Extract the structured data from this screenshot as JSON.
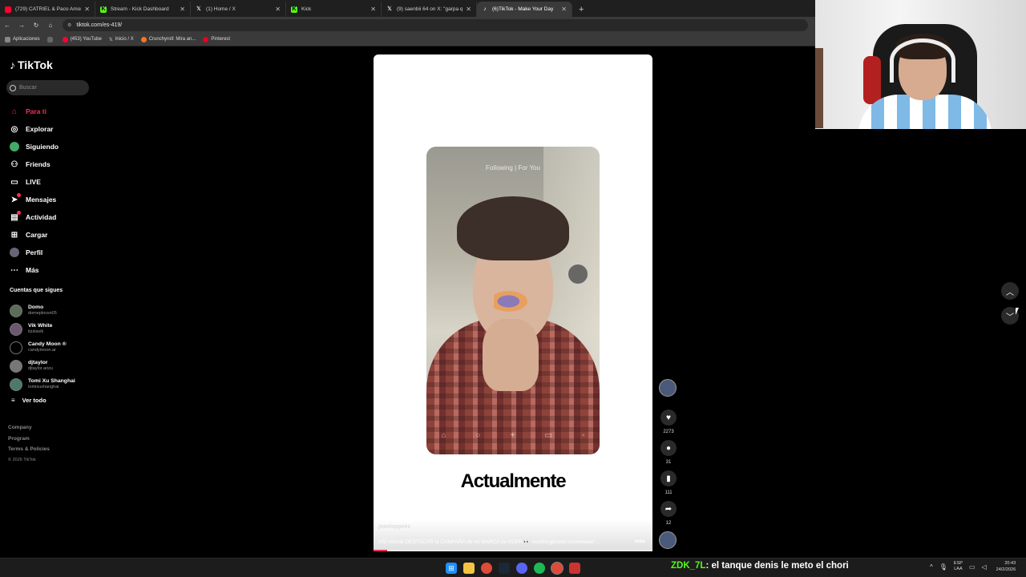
{
  "browser": {
    "tabs": [
      {
        "title": "(729) CATRIEL & Paco Amoroso",
        "fav_color": "#ff0033"
      },
      {
        "title": "Stream - Kick Dashboard",
        "fav_color": "#53fc18"
      },
      {
        "title": "(1) Home / X",
        "fav_color": "#ffffff"
      },
      {
        "title": "Kick",
        "fav_color": "#53fc18"
      },
      {
        "title": "(9) saenbii 64 on X: \"garpa q",
        "fav_color": "#ffffff"
      },
      {
        "title": "(6)TikTok - Make Your Day",
        "fav_color": "#ffffff",
        "active": true
      }
    ],
    "url": "tiktok.com/es-419/",
    "bookmarks": [
      {
        "label": "Aplicaciones"
      },
      {
        "label": "(453) YouTube"
      },
      {
        "label": "Inicio / X"
      },
      {
        "label": "Crunchyroll: Mira an..."
      },
      {
        "label": "Pinterest"
      }
    ]
  },
  "sidebar": {
    "logo": "TikTok",
    "search_placeholder": "Buscar",
    "nav": [
      {
        "label": "Para ti",
        "icon": "home-icon",
        "active": true
      },
      {
        "label": "Explorar",
        "icon": "compass-icon"
      },
      {
        "label": "Siguiendo",
        "icon": "following-icon"
      },
      {
        "label": "Friends",
        "icon": "friends-icon"
      },
      {
        "label": "LIVE",
        "icon": "live-icon"
      },
      {
        "label": "Mensajes",
        "icon": "messages-icon",
        "badge": true
      },
      {
        "label": "Actividad",
        "icon": "activity-icon",
        "badge": true
      },
      {
        "label": "Cargar",
        "icon": "upload-icon"
      },
      {
        "label": "Perfil",
        "icon": "profile-icon"
      },
      {
        "label": "Más",
        "icon": "more-icon"
      }
    ],
    "following_title": "Cuentas que sigues",
    "accounts": [
      {
        "name": "Domo",
        "handle": "domeplovsn05"
      },
      {
        "name": "Vik White",
        "handle": "itzslavik"
      },
      {
        "name": "Candy Moon ®",
        "handle": "candymoon.ar"
      },
      {
        "name": "djtaylor",
        "handle": "djtaylor.arizu"
      },
      {
        "name": "Tomi Xu Shanghai",
        "handle": "tomixushanghai"
      }
    ],
    "see_all": "Ver todo",
    "footer": {
      "company": "Company",
      "program": "Program",
      "terms": "Terms & Policies",
      "copyright": "© 2026 TikTok"
    }
  },
  "video": {
    "overlay_text": "Following | For You",
    "headline": "Actualmente",
    "author": "jeanloppeez",
    "description": "ASÍ intenté DESTACAR la CAMPAÑA de mi MARCA de ROPA 👀 #clothingbrand #streetwear ...",
    "more": "más",
    "progress": 0.05
  },
  "actions": {
    "likes": "2273",
    "comments": "31",
    "saves": "111",
    "shares": "12"
  },
  "stream": {
    "chat_user": "ZDK_7L",
    "chat_message": ": el tanque denis le meto el chori"
  },
  "tray": {
    "lang_top": "ESP",
    "lang_bottom": "LAA",
    "time": "20:43",
    "date": "24/2/2026"
  }
}
